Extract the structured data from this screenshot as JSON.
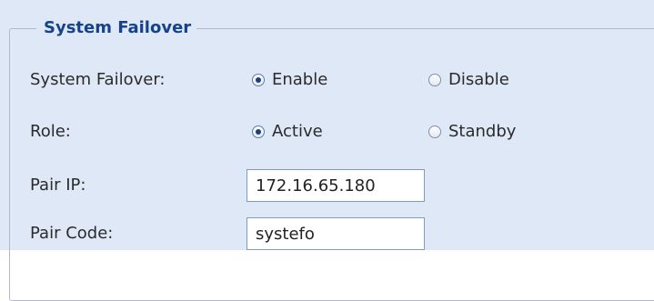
{
  "fieldset": {
    "legend": "System Failover"
  },
  "failover": {
    "label": "System Failover:",
    "options": [
      {
        "label": "Enable",
        "checked": true
      },
      {
        "label": "Disable",
        "checked": false
      }
    ]
  },
  "role": {
    "label": "Role:",
    "options": [
      {
        "label": "Active",
        "checked": true
      },
      {
        "label": "Standby",
        "checked": false
      }
    ]
  },
  "pair_ip": {
    "label": "Pair IP:",
    "value": "172.16.65.180"
  },
  "pair_code": {
    "label": "Pair Code:",
    "value": "systefo"
  },
  "colors": {
    "panel_background": "#dfe8f6",
    "legend_text": "#15428b",
    "fieldset_border": "#b5b8c8",
    "input_border": "#7b9ebd"
  }
}
